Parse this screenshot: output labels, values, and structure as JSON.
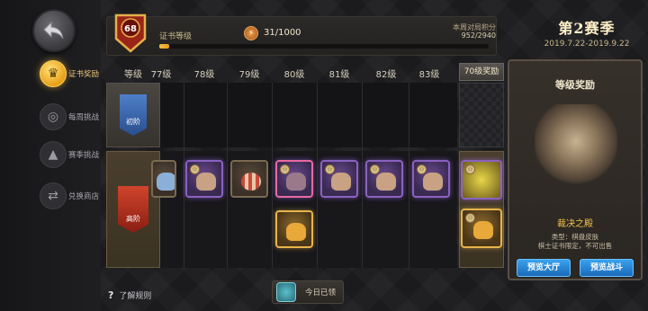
{
  "sidebar": {
    "items": [
      {
        "label": "证书奖励",
        "icon": "certificate-icon",
        "active": true
      },
      {
        "label": "每周挑战",
        "icon": "weekly-challenge-icon",
        "active": false
      },
      {
        "label": "赛季挑战",
        "icon": "season-challenge-icon",
        "active": false
      },
      {
        "label": "兑换商店",
        "icon": "exchange-shop-icon",
        "active": false
      }
    ],
    "help_label": "了解规则"
  },
  "topbar": {
    "level": "68",
    "cert_label": "证书等级",
    "xp_progress": "31/1000",
    "xp_fraction": 0.031,
    "weekly_label": "本周对局积分",
    "weekly_value": "952/2940"
  },
  "season": {
    "title": "第2赛季",
    "dates": "2019.7.22-2019.9.22"
  },
  "grid": {
    "header_label": "等级",
    "levels": [
      "77级",
      "78级",
      "79级",
      "80级",
      "81级",
      "82级",
      "83级"
    ],
    "reward_col_label": "70级奖励",
    "tiers": [
      {
        "label": "初阶",
        "color": "#3a6aae"
      },
      {
        "label": "高阶",
        "color": "#b0301c"
      }
    ]
  },
  "panel": {
    "title": "等级奖励",
    "item_name": "裁决之殿",
    "item_type": "类型：棋盘皮肤",
    "item_note": "棋士证书限定，不可出售",
    "btn_hall": "预览大厅",
    "btn_battle": "预览战斗"
  },
  "daily": {
    "label": "今日已领"
  }
}
